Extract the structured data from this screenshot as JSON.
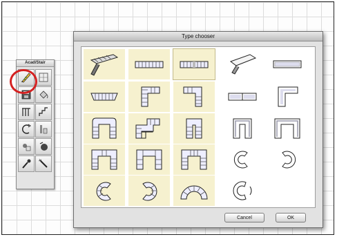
{
  "palette": {
    "title": "Acad/Stair",
    "tools": [
      {
        "name": "stair-tool",
        "icon": "stair-pencil-icon",
        "selected": true
      },
      {
        "name": "view-tool",
        "icon": "stair-view-icon"
      },
      {
        "name": "save-tool",
        "icon": "floppy-icon"
      },
      {
        "name": "paint-tool",
        "icon": "paint-bucket-icon"
      },
      {
        "name": "railing-tool",
        "icon": "railing-icon"
      },
      {
        "name": "stringer-tool",
        "icon": "stringer-icon"
      },
      {
        "name": "curve-tool",
        "icon": "curve-stair-icon"
      },
      {
        "name": "landing-tool",
        "icon": "landing-icon"
      },
      {
        "name": "eraser-tool",
        "icon": "eraser-icon"
      },
      {
        "name": "rotate-tool",
        "icon": "rotate-icon"
      },
      {
        "name": "dropper-tool",
        "icon": "dropper-icon"
      },
      {
        "name": "wand-tool",
        "icon": "wand-icon"
      }
    ]
  },
  "dialog": {
    "title": "Type chooser",
    "cancel_label": "Cancel",
    "ok_label": "OK",
    "stair_types": [
      "ramp-3d",
      "straight-plan",
      "straight-plan-alt",
      "ramp-3d-light",
      "straight-plain",
      "splayed-straight",
      "l-shape",
      "l-shape-reverse",
      "straight-landing",
      "l-shape-plain",
      "u-shape",
      "z-shape",
      "u-shape-narrow",
      "u-plain",
      "u-plain-wide",
      "u-wide",
      "u-double",
      "u-triple",
      "spiral-plain",
      "spiral-plain-alt",
      "spiral",
      "spiral-alt",
      "semicircle",
      "semicircle-plain"
    ]
  }
}
